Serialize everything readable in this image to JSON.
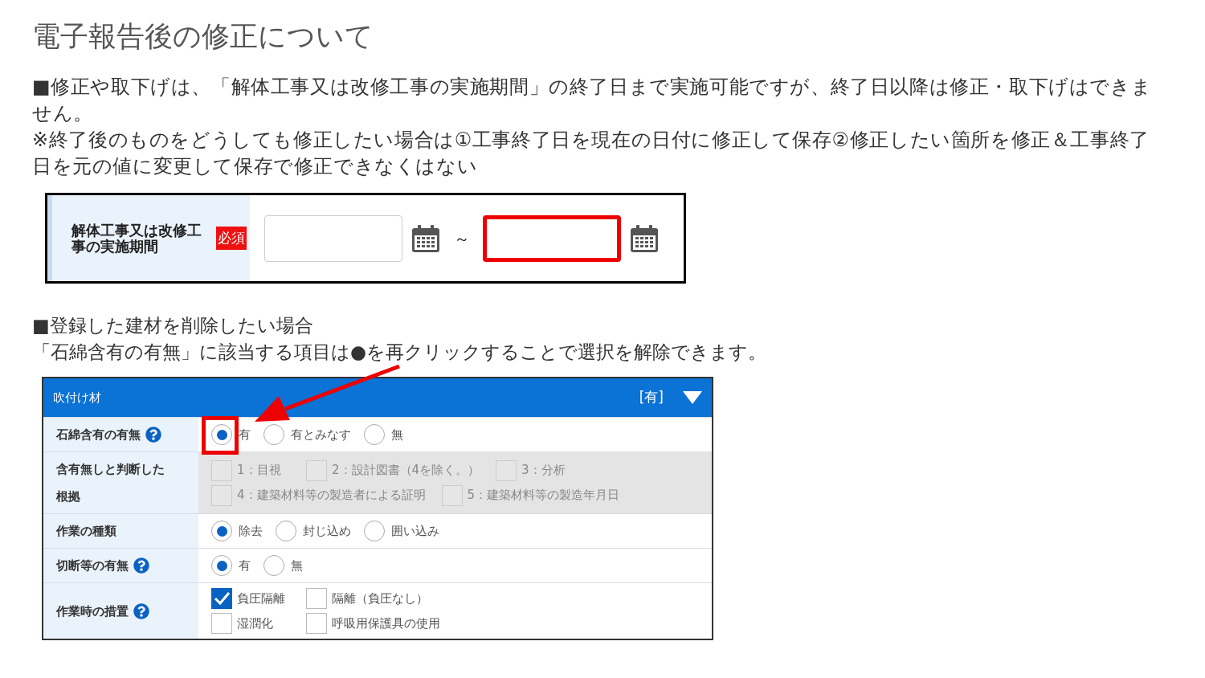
{
  "title": "電子報告後の修正について",
  "notes": [
    "■修正や取下げは、「解体工事又は改修工事の実施期間」の終了日まで実施可能ですが、終了日以降は修正・取下げはできません。",
    "※終了後のものをどうしても修正したい場合は①工事終了日を現在の日付に修正して保存②修正したい箇所を修正＆工事終了日を元の値に変更して保存で修正できなくはない"
  ],
  "period_field": {
    "label": "解体工事又は改修工事の実施期間",
    "required_badge": "必須",
    "separator": "～",
    "inputs": [
      {
        "highlighted": false
      },
      {
        "highlighted": true
      }
    ]
  },
  "section2": {
    "heading": "■登録した建材を削除したい場合",
    "text": "「石綿含有の有無」に該当する項目は●を再クリックすることで選択を解除できます。"
  },
  "material_panel": {
    "title": "吹付け材",
    "status": "[有]",
    "expanded": true,
    "rows": [
      {
        "label": "石綿含有の有無",
        "help": true,
        "kind": "radio",
        "disabled": false,
        "lines": [
          {
            "options": [
              {
                "label": "有",
                "selected": true,
                "highlighted": true
              },
              {
                "label": "有とみなす",
                "selected": false,
                "highlighted": false
              },
              {
                "label": "無",
                "selected": false,
                "highlighted": false
              }
            ]
          }
        ]
      },
      {
        "label": "含有無しと判断した根拠",
        "help": false,
        "kind": "checkbox",
        "disabled": true,
        "lines": [
          {
            "options": [
              {
                "label": "1：目視",
                "checked": false
              },
              {
                "label": "2：設計図書（4を除く。）",
                "checked": false
              },
              {
                "label": "3：分析",
                "checked": false
              }
            ]
          },
          {
            "options": [
              {
                "label": "4：建築材料等の製造者による証明",
                "checked": false
              },
              {
                "label": "5：建築材料等の製造年月日",
                "checked": false
              }
            ]
          }
        ]
      },
      {
        "label": "作業の種類",
        "help": false,
        "kind": "radio",
        "disabled": false,
        "lines": [
          {
            "options": [
              {
                "label": "除去",
                "selected": true,
                "highlighted": false
              },
              {
                "label": "封じ込め",
                "selected": false,
                "highlighted": false
              },
              {
                "label": "囲い込み",
                "selected": false,
                "highlighted": false
              }
            ]
          }
        ]
      },
      {
        "label": "切断等の有無",
        "help": true,
        "kind": "radio",
        "disabled": false,
        "lines": [
          {
            "options": [
              {
                "label": "有",
                "selected": true,
                "highlighted": false
              },
              {
                "label": "無",
                "selected": false,
                "highlighted": false
              }
            ]
          }
        ]
      },
      {
        "label": "作業時の措置",
        "help": true,
        "kind": "checkbox",
        "disabled": false,
        "lines": [
          {
            "options": [
              {
                "label": "負圧隔離",
                "checked": true
              },
              {
                "label": "隔離（負圧なし）",
                "checked": false
              }
            ]
          },
          {
            "options": [
              {
                "label": "湿潤化",
                "checked": false
              },
              {
                "label": "呼吸用保護具の使用",
                "checked": false
              }
            ]
          }
        ]
      }
    ]
  }
}
